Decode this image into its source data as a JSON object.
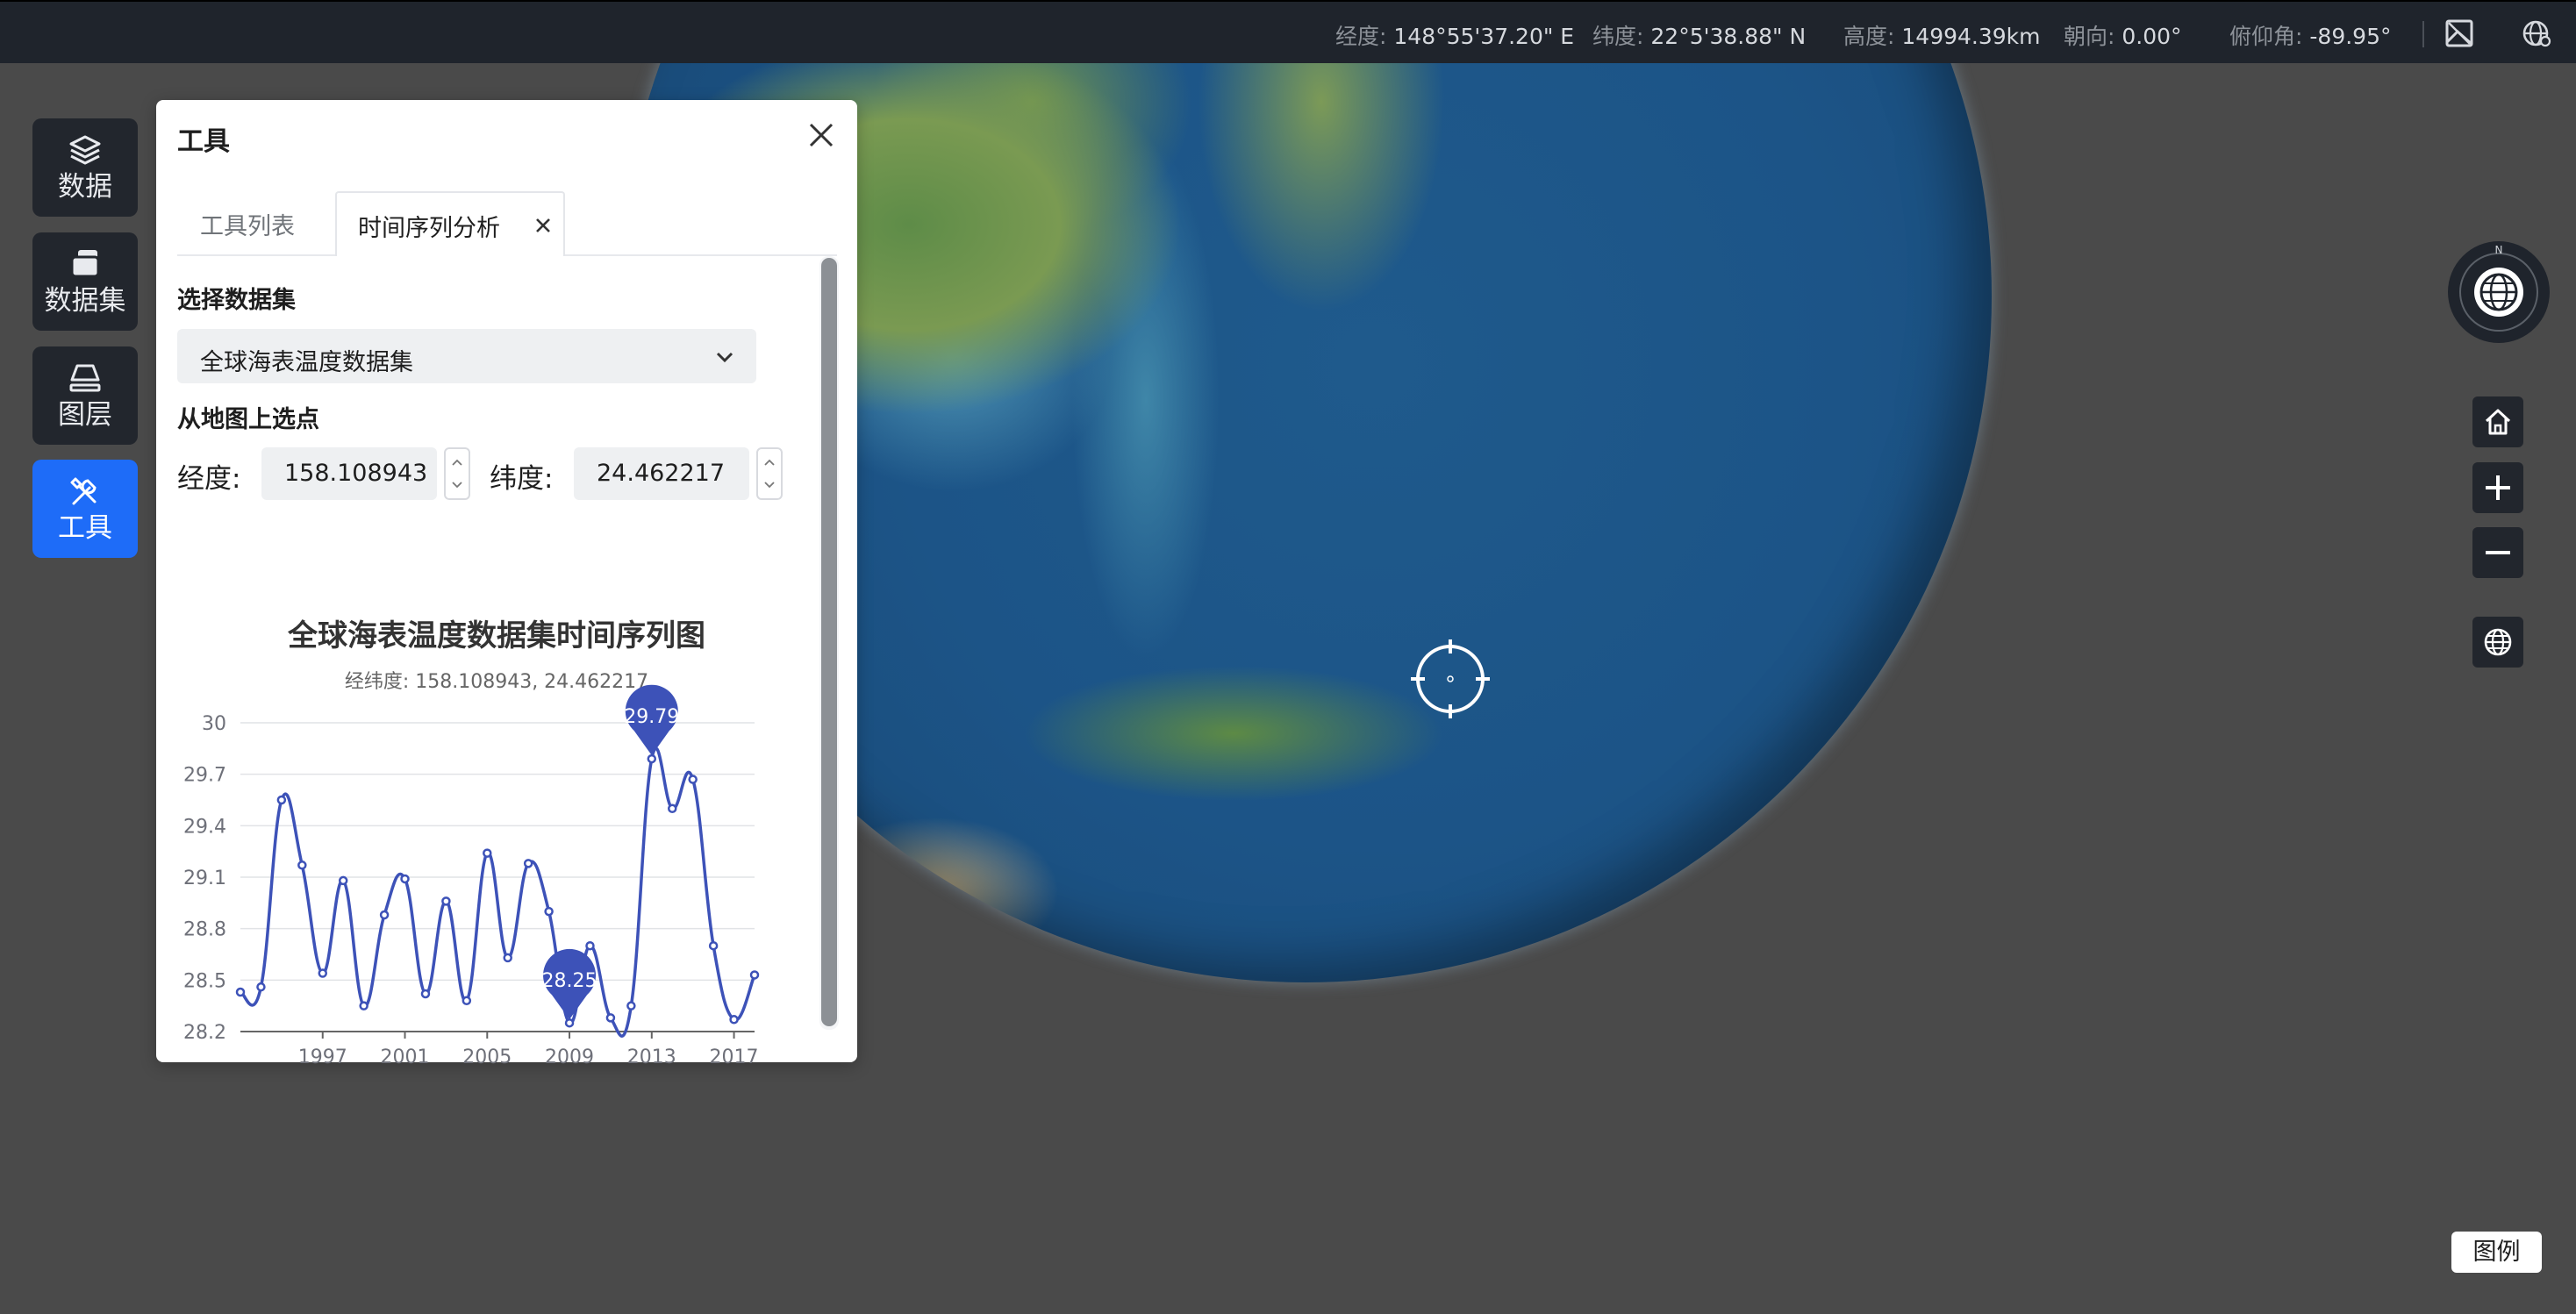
{
  "status_bar": {
    "longitude": {
      "label": "经度:",
      "value": "148°55'37.20\" E"
    },
    "latitude": {
      "label": "纬度:",
      "value": "22°5'38.88\" N"
    },
    "altitude": {
      "label": "高度:",
      "value": "14994.39km"
    },
    "heading": {
      "label": "朝向:",
      "value": "0.00°"
    },
    "pitch": {
      "label": "俯仰角:",
      "value": "-89.95°"
    },
    "icons": [
      "map-image-icon",
      "globe-settings-icon"
    ]
  },
  "dock": {
    "items": [
      {
        "label": "数据",
        "icon": "layers-icon",
        "active": false
      },
      {
        "label": "数据集",
        "icon": "cards-icon",
        "active": false
      },
      {
        "label": "图层",
        "icon": "layer-plane-icon",
        "active": false
      },
      {
        "label": "工具",
        "icon": "tools-icon",
        "active": true
      }
    ]
  },
  "panel": {
    "title": "工具",
    "tabs": [
      {
        "label": "工具列表",
        "active": false
      },
      {
        "label": "时间序列分析",
        "active": true,
        "closable": true
      }
    ],
    "dataset_section": "选择数据集",
    "dataset_value": "全球海表温度数据集",
    "pick_section": "从地图上选点",
    "lon_label": "经度:",
    "lon_value": "158.108943",
    "lat_label": "纬度:",
    "lat_value": "24.462217"
  },
  "chart_data": {
    "type": "line",
    "title": "全球海表温度数据集时间序列图",
    "subtitle": "经纬度: 158.108943, 24.462217",
    "x": [
      1993,
      1994,
      1995,
      1996,
      1997,
      1998,
      1999,
      2000,
      2001,
      2002,
      2003,
      2004,
      2005,
      2006,
      2007,
      2008,
      2009,
      2010,
      2011,
      2012,
      2013,
      2014,
      2015,
      2016,
      2017,
      2018
    ],
    "values": [
      28.43,
      28.46,
      29.55,
      29.17,
      28.54,
      29.08,
      28.35,
      28.88,
      29.09,
      28.42,
      28.96,
      28.38,
      29.24,
      28.63,
      29.18,
      28.9,
      28.25,
      28.7,
      28.28,
      28.35,
      29.79,
      29.5,
      29.67,
      28.7,
      28.27,
      28.53
    ],
    "y_ticks": [
      28.2,
      28.5,
      28.8,
      29.1,
      29.4,
      29.7,
      30
    ],
    "x_ticks": [
      1997,
      2001,
      2005,
      2009,
      2013,
      2017
    ],
    "ylim": [
      28.2,
      30
    ],
    "grid": true,
    "markers": [
      {
        "label": "29.79",
        "x": 2013,
        "value": 29.79,
        "kind": "max"
      },
      {
        "label": "28.25",
        "x": 2009,
        "value": 28.25,
        "kind": "min"
      }
    ],
    "color": "#3d52b8"
  },
  "controls": {
    "compass_letter": "N",
    "buttons": [
      "home-icon",
      "zoom-in-icon",
      "zoom-out-icon",
      "globe-icon"
    ],
    "legend_label": "图例"
  },
  "colors": {
    "topbar": "#1f242c",
    "dock_active": "#1e6cf8",
    "dock": "#22262d",
    "series": "#3d52b8"
  }
}
